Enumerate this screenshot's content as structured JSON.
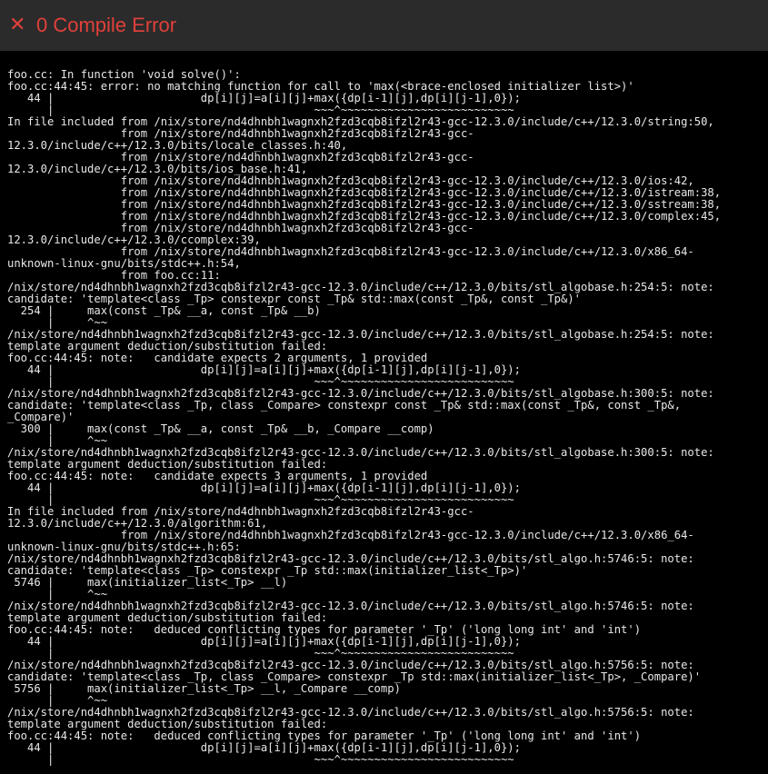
{
  "header": {
    "icon": "close-icon",
    "title": "0 Compile Error",
    "accent_color": "#e0403a"
  },
  "console": {
    "lines": [
      "foo.cc: In function 'void solve()':",
      "foo.cc:44:45: error: no matching function for call to 'max(<brace-enclosed initializer list>)'",
      "   44 |                      dp[i][j]=a[i][j]+max({dp[i-1][j],dp[i][j-1],0});",
      "      |                                       ~~~^~~~~~~~~~~~~~~~~~~~~~~~~~~",
      "In file included from /nix/store/nd4dhnbh1wagnxh2fzd3cqb8ifzl2r43-gcc-12.3.0/include/c++/12.3.0/string:50,",
      "                 from /nix/store/nd4dhnbh1wagnxh2fzd3cqb8ifzl2r43-gcc-",
      "12.3.0/include/c++/12.3.0/bits/locale_classes.h:40,",
      "                 from /nix/store/nd4dhnbh1wagnxh2fzd3cqb8ifzl2r43-gcc-",
      "12.3.0/include/c++/12.3.0/bits/ios_base.h:41,",
      "                 from /nix/store/nd4dhnbh1wagnxh2fzd3cqb8ifzl2r43-gcc-12.3.0/include/c++/12.3.0/ios:42,",
      "                 from /nix/store/nd4dhnbh1wagnxh2fzd3cqb8ifzl2r43-gcc-12.3.0/include/c++/12.3.0/istream:38,",
      "                 from /nix/store/nd4dhnbh1wagnxh2fzd3cqb8ifzl2r43-gcc-12.3.0/include/c++/12.3.0/sstream:38,",
      "                 from /nix/store/nd4dhnbh1wagnxh2fzd3cqb8ifzl2r43-gcc-12.3.0/include/c++/12.3.0/complex:45,",
      "                 from /nix/store/nd4dhnbh1wagnxh2fzd3cqb8ifzl2r43-gcc-",
      "12.3.0/include/c++/12.3.0/ccomplex:39,",
      "                 from /nix/store/nd4dhnbh1wagnxh2fzd3cqb8ifzl2r43-gcc-12.3.0/include/c++/12.3.0/x86_64-",
      "unknown-linux-gnu/bits/stdc++.h:54,",
      "                 from foo.cc:11:",
      "/nix/store/nd4dhnbh1wagnxh2fzd3cqb8ifzl2r43-gcc-12.3.0/include/c++/12.3.0/bits/stl_algobase.h:254:5: note:",
      "candidate: 'template<class _Tp> constexpr const _Tp& std::max(const _Tp&, const _Tp&)'",
      "  254 |     max(const _Tp& __a, const _Tp& __b)",
      "      |     ^~~",
      "/nix/store/nd4dhnbh1wagnxh2fzd3cqb8ifzl2r43-gcc-12.3.0/include/c++/12.3.0/bits/stl_algobase.h:254:5: note:",
      "template argument deduction/substitution failed:",
      "foo.cc:44:45: note:   candidate expects 2 arguments, 1 provided",
      "   44 |                      dp[i][j]=a[i][j]+max({dp[i-1][j],dp[i][j-1],0});",
      "      |                                       ~~~^~~~~~~~~~~~~~~~~~~~~~~~~~~",
      "/nix/store/nd4dhnbh1wagnxh2fzd3cqb8ifzl2r43-gcc-12.3.0/include/c++/12.3.0/bits/stl_algobase.h:300:5: note:",
      "candidate: 'template<class _Tp, class _Compare> constexpr const _Tp& std::max(const _Tp&, const _Tp&,",
      "_Compare)'",
      "  300 |     max(const _Tp& __a, const _Tp& __b, _Compare __comp)",
      "      |     ^~~",
      "/nix/store/nd4dhnbh1wagnxh2fzd3cqb8ifzl2r43-gcc-12.3.0/include/c++/12.3.0/bits/stl_algobase.h:300:5: note:",
      "template argument deduction/substitution failed:",
      "foo.cc:44:45: note:   candidate expects 3 arguments, 1 provided",
      "   44 |                      dp[i][j]=a[i][j]+max({dp[i-1][j],dp[i][j-1],0});",
      "      |                                       ~~~^~~~~~~~~~~~~~~~~~~~~~~~~~~",
      "In file included from /nix/store/nd4dhnbh1wagnxh2fzd3cqb8ifzl2r43-gcc-",
      "12.3.0/include/c++/12.3.0/algorithm:61,",
      "                 from /nix/store/nd4dhnbh1wagnxh2fzd3cqb8ifzl2r43-gcc-12.3.0/include/c++/12.3.0/x86_64-",
      "unknown-linux-gnu/bits/stdc++.h:65:",
      "/nix/store/nd4dhnbh1wagnxh2fzd3cqb8ifzl2r43-gcc-12.3.0/include/c++/12.3.0/bits/stl_algo.h:5746:5: note:",
      "candidate: 'template<class _Tp> constexpr _Tp std::max(initializer_list<_Tp>)'",
      " 5746 |     max(initializer_list<_Tp> __l)",
      "      |     ^~~",
      "/nix/store/nd4dhnbh1wagnxh2fzd3cqb8ifzl2r43-gcc-12.3.0/include/c++/12.3.0/bits/stl_algo.h:5746:5: note:",
      "template argument deduction/substitution failed:",
      "foo.cc:44:45: note:   deduced conflicting types for parameter '_Tp' ('long long int' and 'int')",
      "   44 |                      dp[i][j]=a[i][j]+max({dp[i-1][j],dp[i][j-1],0});",
      "      |                                       ~~~^~~~~~~~~~~~~~~~~~~~~~~~~~~",
      "/nix/store/nd4dhnbh1wagnxh2fzd3cqb8ifzl2r43-gcc-12.3.0/include/c++/12.3.0/bits/stl_algo.h:5756:5: note:",
      "candidate: 'template<class _Tp, class _Compare> constexpr _Tp std::max(initializer_list<_Tp>, _Compare)'",
      " 5756 |     max(initializer_list<_Tp> __l, _Compare __comp)",
      "      |     ^~~",
      "/nix/store/nd4dhnbh1wagnxh2fzd3cqb8ifzl2r43-gcc-12.3.0/include/c++/12.3.0/bits/stl_algo.h:5756:5: note:",
      "template argument deduction/substitution failed:",
      "foo.cc:44:45: note:   deduced conflicting types for parameter '_Tp' ('long long int' and 'int')",
      "   44 |                      dp[i][j]=a[i][j]+max({dp[i-1][j],dp[i][j-1],0});",
      "      |                                       ~~~^~~~~~~~~~~~~~~~~~~~~~~~~~~"
    ]
  }
}
